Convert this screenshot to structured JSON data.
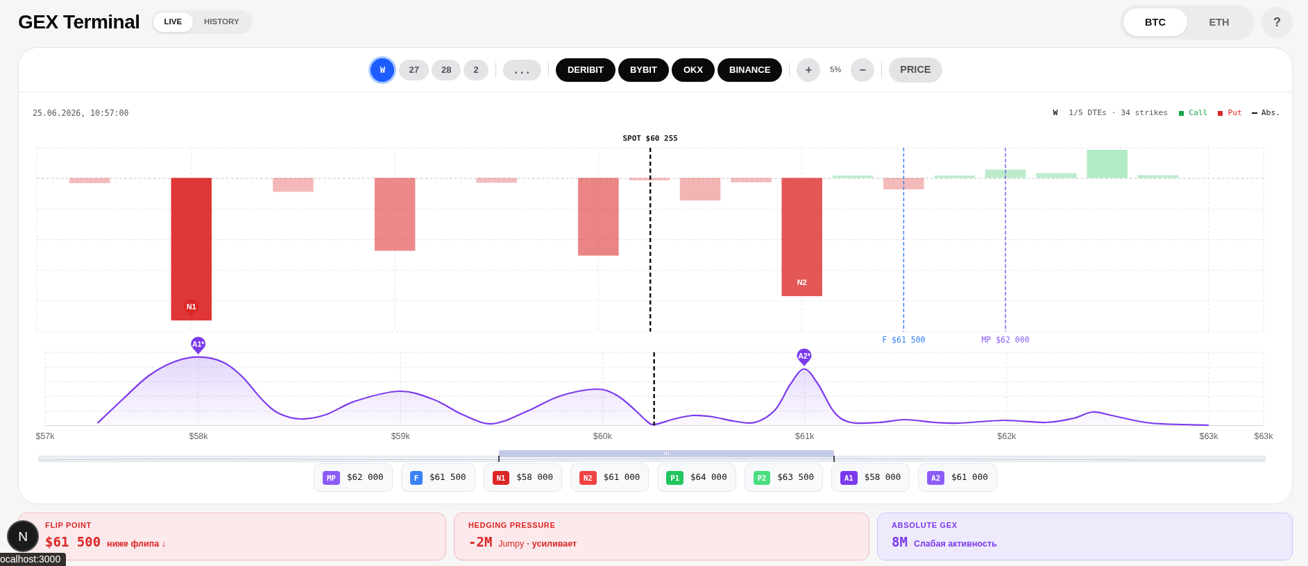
{
  "header": {
    "title": "GEX Terminal",
    "modes": [
      {
        "label": "LIVE",
        "selected": true
      },
      {
        "label": "HISTORY",
        "selected": false
      }
    ],
    "assets": [
      {
        "label": "BTC",
        "selected": true
      },
      {
        "label": "ETH",
        "selected": false
      }
    ],
    "help_button": "?"
  },
  "toolbar": {
    "expiries": [
      {
        "label": "W",
        "selected": true
      },
      {
        "label": "27",
        "selected": false
      },
      {
        "label": "28",
        "selected": false
      },
      {
        "label": "2",
        "selected": false
      }
    ],
    "more_button": "...",
    "exchanges": [
      {
        "label": "DERIBIT",
        "selected": true
      },
      {
        "label": "BYBIT",
        "selected": true
      },
      {
        "label": "OKX",
        "selected": true
      },
      {
        "label": "BINANCE",
        "selected": true
      }
    ],
    "zoom_in_button": "+",
    "zoom_level": "5%",
    "zoom_out_button": "−",
    "price_button": "PRICE"
  },
  "chart": {
    "timestamp": "25.06.2026, 10:57:00",
    "legend": {
      "expiry": "W",
      "summary": "1/5 DTEs · 34 strikes",
      "items": [
        {
          "label": "Call",
          "kind": "square",
          "color": "#16a34a"
        },
        {
          "label": "Put",
          "kind": "square",
          "color": "#dc2626"
        },
        {
          "label": "Abs.",
          "kind": "line",
          "color": "#111111"
        }
      ]
    },
    "spot_label": "SPOT $60 255",
    "flip_label": "F $61 500",
    "max_pain_label": "MP $62 000",
    "bar_markers": [
      {
        "label": "N1",
        "kind": "pin"
      },
      {
        "label": "N2",
        "kind": "inside"
      }
    ],
    "curve_markers": [
      {
        "label": "A1*"
      },
      {
        "label": "A2*"
      }
    ],
    "x_axis_labels": [
      "$57k",
      "$58k",
      "$59k",
      "$60k",
      "$61k",
      "$62k",
      "$63k",
      "$63k"
    ]
  },
  "levels": [
    {
      "tag": "MP",
      "value": "$62 000",
      "color": "#8b5cf6"
    },
    {
      "tag": "F",
      "value": "$61 500",
      "color": "#3b82f6"
    },
    {
      "tag": "N1",
      "value": "$58 000",
      "color": "#dc2626"
    },
    {
      "tag": "N2",
      "value": "$61 000",
      "color": "#ef4444"
    },
    {
      "tag": "P1",
      "value": "$64 000",
      "color": "#22c55e"
    },
    {
      "tag": "P2",
      "value": "$63 500",
      "color": "#4ade80"
    },
    {
      "tag": "A1",
      "value": "$58 000",
      "color": "#7c3aed"
    },
    {
      "tag": "A2",
      "value": "$61 000",
      "color": "#8b5cf6"
    }
  ],
  "stats": [
    {
      "kind": "danger",
      "label": "FLIP POINT",
      "value": "$61 500",
      "note": "ниже флипа ↓"
    },
    {
      "kind": "danger",
      "label": "HEDGING PRESSURE",
      "value": "-2M",
      "tag": "Jumpy",
      "note": "· усиливает"
    },
    {
      "kind": "accent",
      "label": "ABSOLUTE GEX",
      "value": "8M",
      "note": "Слабая активность"
    }
  ],
  "dev_overlay": {
    "badge": "N",
    "tooltip": "ocalhost:3000"
  }
}
